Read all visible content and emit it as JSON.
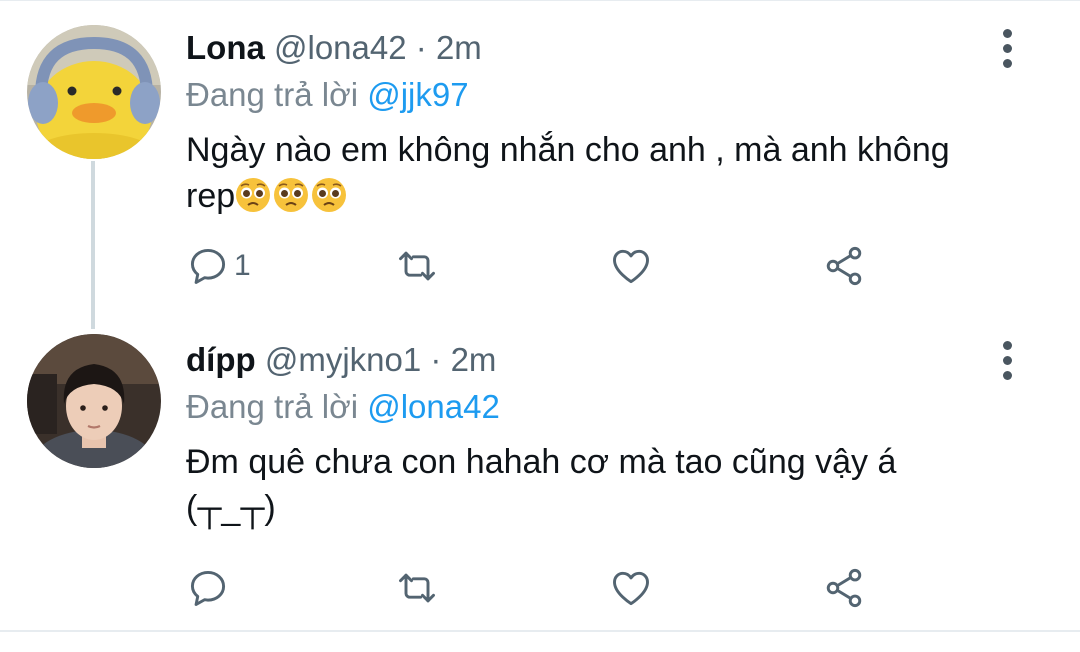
{
  "tweets": [
    {
      "display_name": "Lona",
      "handle": "@lona42",
      "separator": "·",
      "time": "2m",
      "replying_prefix": "Đang trả lời",
      "replying_to": "@jjk97",
      "text_line1": "Ngày nào em không nhắn cho anh , mà anh không",
      "text_line2": "rep",
      "emoji": "pleading-face",
      "emoji_count": 3,
      "reply_count": "1",
      "avatar": "duck-with-headphones"
    },
    {
      "display_name": "dípp",
      "handle": "@myjkno1",
      "separator": "·",
      "time": "2m",
      "replying_prefix": "Đang trả lời",
      "replying_to": "@lona42",
      "text_line1": "Đm quê chưa con hahah cơ mà tao cũng vậy á",
      "text_line2": "(┬_┬)",
      "reply_count": "",
      "avatar": "person-photo"
    }
  ],
  "icons": {
    "reply": "reply-icon",
    "retweet": "retweet-icon",
    "like": "heart-icon",
    "share": "share-icon",
    "more": "more-vertical-icon"
  },
  "colors": {
    "name": "#0f1419",
    "meta": "#536471",
    "mention": "#1d9bf0",
    "thread_line": "#cfd9de",
    "icon": "#536471"
  }
}
